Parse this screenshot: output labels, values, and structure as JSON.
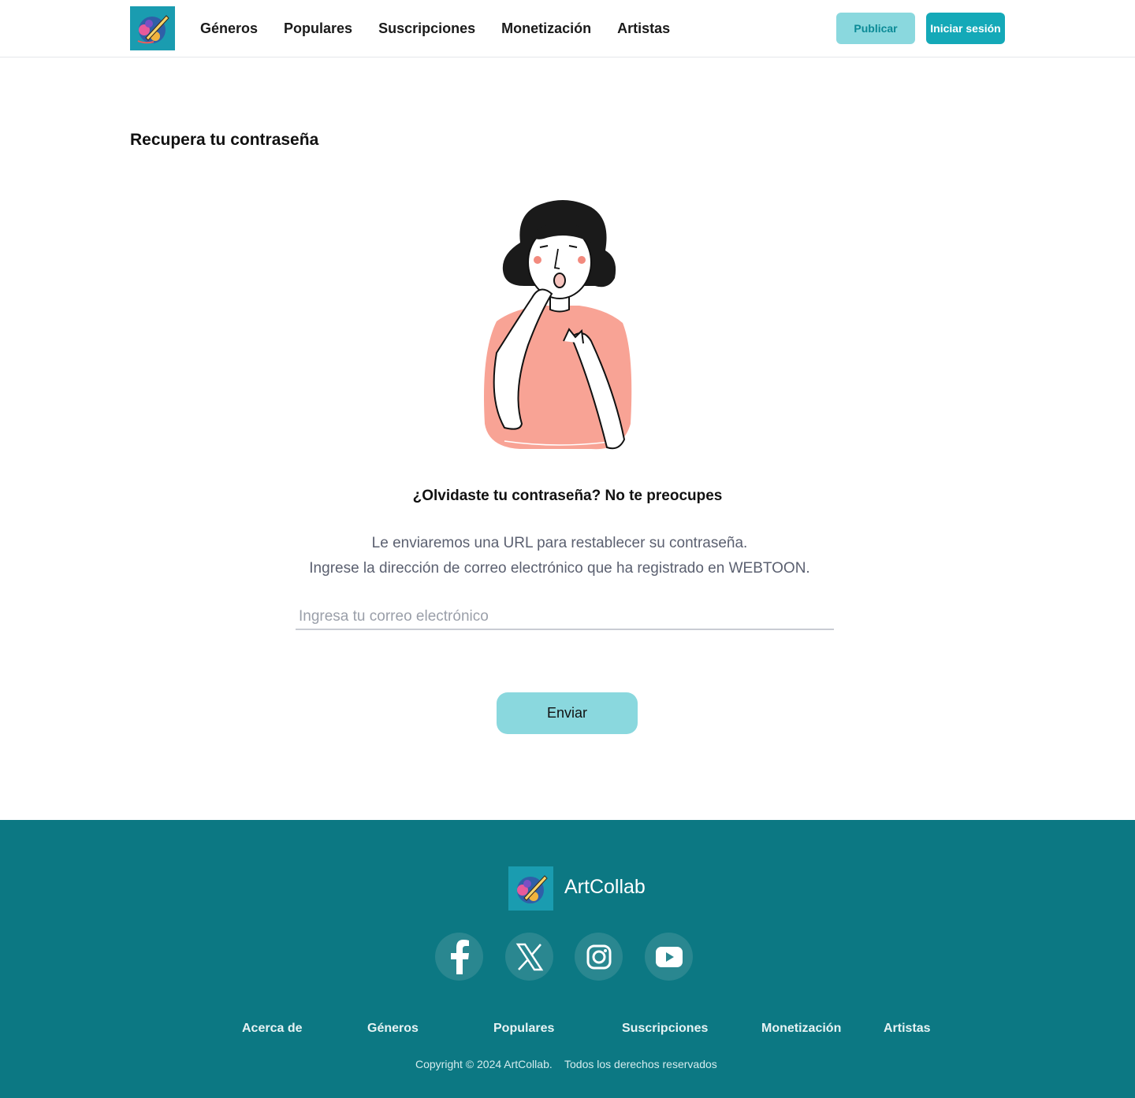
{
  "header": {
    "nav": [
      "Géneros",
      "Populares",
      "Suscripciones",
      "Monetización",
      "Artistas"
    ],
    "publish_label": "Publicar",
    "login_label": "Iniciar sesión"
  },
  "main": {
    "title": "Recupera tu contraseña",
    "subtitle": "¿Olvidaste tu contraseña? No te preocupes",
    "desc_line1": "Le enviaremos una URL para restablecer su contraseña.",
    "desc_line2": "Ingrese la dirección de correo electrónico que ha registrado en WEBTOON.",
    "email_placeholder": "Ingresa tu correo electrónico",
    "email_value": "",
    "send_label": "Enviar"
  },
  "footer": {
    "brand": "ArtCollab",
    "social": [
      "facebook-icon",
      "x-icon",
      "instagram-icon",
      "youtube-icon"
    ],
    "links": [
      "Acerca de",
      "Géneros",
      "Populares",
      "Suscripciones",
      "Monetización",
      "Artistas"
    ],
    "copyright": "Copyright © 2024 ArtCollab.",
    "rights": "Todos los derechos reservados"
  },
  "colors": {
    "accent": "#14a9b8",
    "accent_light": "#8ad8de",
    "footer_bg": "#0c7883",
    "shirt": "#f8a395"
  }
}
